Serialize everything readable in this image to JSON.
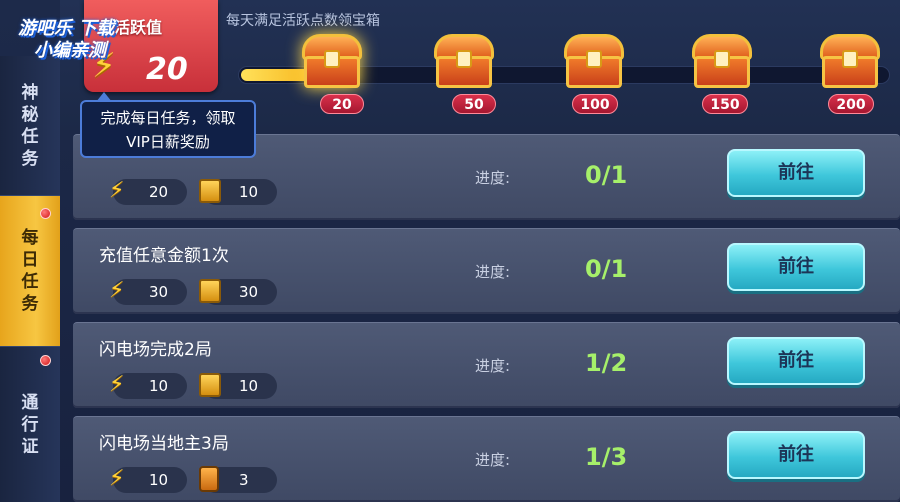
{
  "watermark": {
    "line1": "游吧乐 下载",
    "line2": "小编亲测"
  },
  "header": {
    "activity_title": "活跃值",
    "activity_value": "20",
    "description": "每天满足活跃点数领宝箱",
    "progress": 0.12
  },
  "tooltip": {
    "text": "完成每日任务，领取VIP日薪奖励"
  },
  "sidebar": {
    "items": [
      {
        "label": "神秘任务",
        "active": false,
        "dot": false
      },
      {
        "label": "每日任务",
        "active": true,
        "dot": true
      },
      {
        "label": "通行证",
        "active": false,
        "dot": true
      }
    ]
  },
  "chests": [
    {
      "label": "20",
      "icon": "treasure-chest-icon",
      "highlighted": true
    },
    {
      "label": "50",
      "icon": "treasure-chest-icon",
      "highlighted": false
    },
    {
      "label": "100",
      "icon": "treasure-chest-icon",
      "highlighted": false
    },
    {
      "label": "150",
      "icon": "treasure-chest-icon",
      "highlighted": false
    },
    {
      "label": "200",
      "icon": "treasure-chest-icon",
      "highlighted": false
    }
  ],
  "tasks": [
    {
      "title": "",
      "reward1": "20",
      "reward2": "10",
      "reward2_icon": "gold-card-icon",
      "progress_label": "进度:",
      "progress": "0/1",
      "button": "前往"
    },
    {
      "title": "充值任意金额1次",
      "reward1": "30",
      "reward2": "30",
      "reward2_icon": "gold-card-icon",
      "progress_label": "进度:",
      "progress": "0/1",
      "button": "前往"
    },
    {
      "title": "闪电场完成2局",
      "reward1": "10",
      "reward2": "10",
      "reward2_icon": "gold-card-icon",
      "progress_label": "进度:",
      "progress": "1/2",
      "button": "前往"
    },
    {
      "title": "闪电场当地主3局",
      "reward1": "10",
      "reward2": "3",
      "reward2_icon": "card-icon",
      "progress_label": "进度:",
      "progress": "1/3",
      "button": "前往"
    }
  ],
  "colors": {
    "accent": "#3fc7db",
    "active_tab": "#f7c642",
    "progress_green": "#a6f06a",
    "badge_red": "#c8303a"
  }
}
